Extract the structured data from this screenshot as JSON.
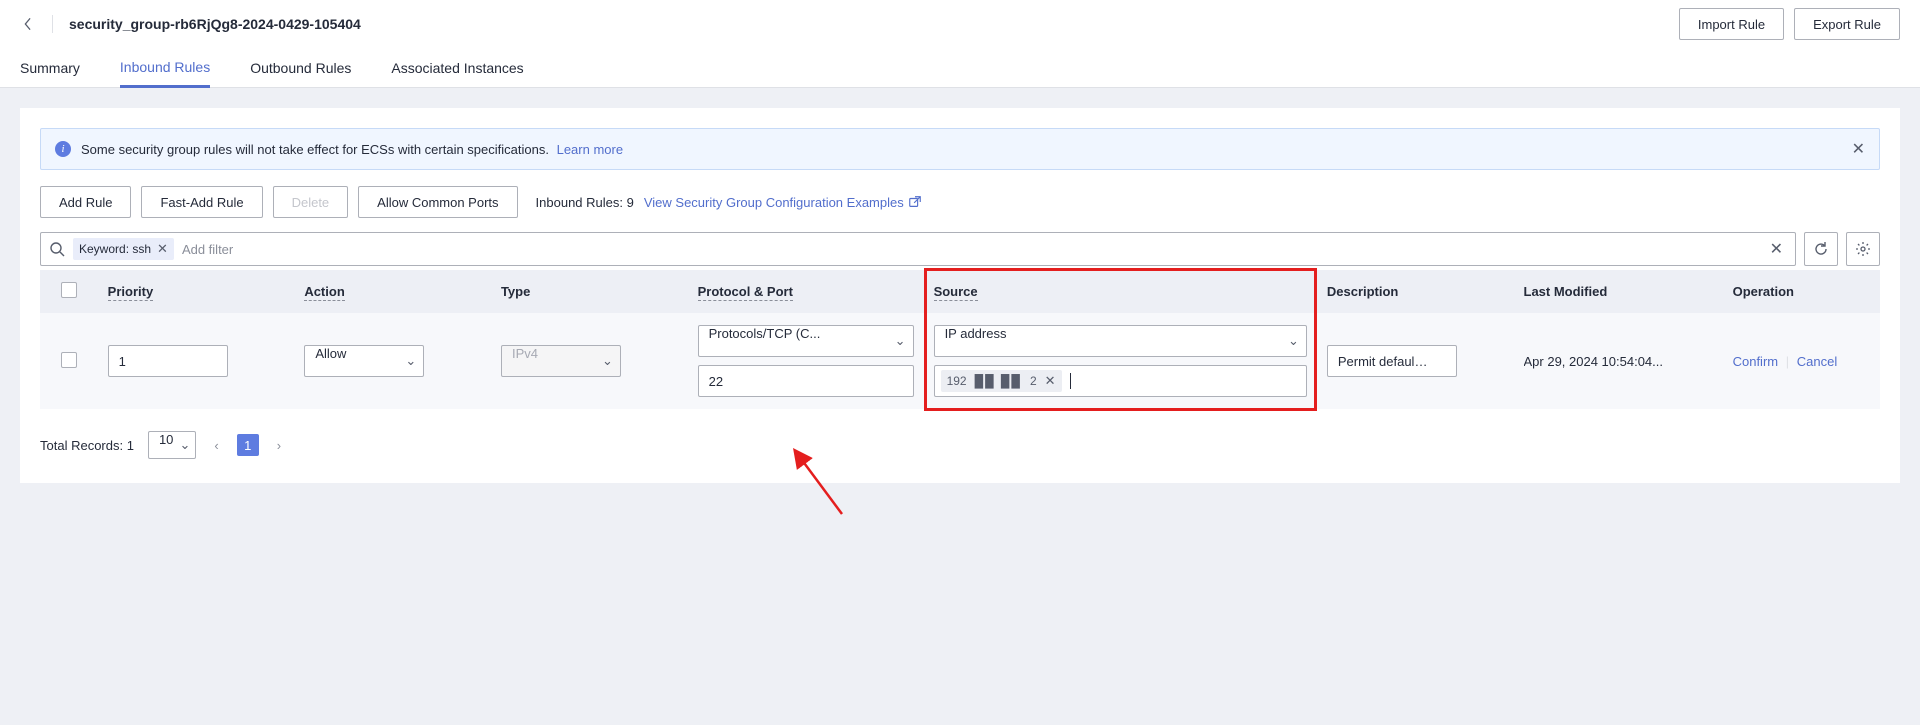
{
  "header": {
    "title": "security_group-rb6RjQg8-2024-0429-105404",
    "import_rule": "Import Rule",
    "export_rule": "Export Rule"
  },
  "tabs": {
    "summary": "Summary",
    "inbound": "Inbound Rules",
    "outbound": "Outbound Rules",
    "associated": "Associated Instances"
  },
  "banner": {
    "text": "Some security group rules will not take effect for ECSs with certain specifications.",
    "learn_more": "Learn more"
  },
  "toolbar": {
    "add_rule": "Add Rule",
    "fast_add": "Fast-Add Rule",
    "delete": "Delete",
    "allow_common": "Allow Common Ports",
    "inbound_label": "Inbound Rules:",
    "inbound_count": "9",
    "config_examples": "View Security Group Configuration Examples"
  },
  "filter": {
    "chip_text": "Keyword: ssh",
    "placeholder": "Add filter"
  },
  "columns": {
    "priority": "Priority",
    "action": "Action",
    "type": "Type",
    "protocol": "Protocol & Port",
    "source": "Source",
    "description": "Description",
    "modified": "Last Modified",
    "operation": "Operation"
  },
  "row": {
    "priority": "1",
    "action": "Allow",
    "type": "IPv4",
    "protocol": "Protocols/TCP (C...",
    "port": "22",
    "source_type": "IP address",
    "ip_start": "192",
    "ip_end": "2",
    "description": "Permit default Linux S",
    "modified": "Apr 29, 2024 10:54:04...",
    "confirm": "Confirm",
    "cancel": "Cancel"
  },
  "pager": {
    "total_label": "Total Records:",
    "total": "1",
    "page_size": "10",
    "current": "1"
  },
  "annotation": {
    "highlight_color": "#e41e1e"
  }
}
